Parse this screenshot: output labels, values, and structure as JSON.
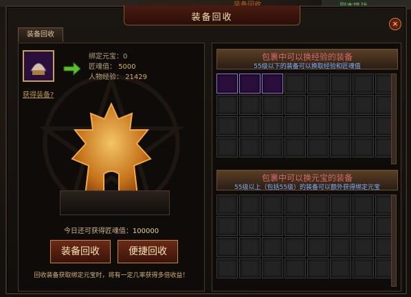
{
  "background": {
    "top_mid_text": "装备回收",
    "top_right_text": "副本挑战"
  },
  "window": {
    "title": "装备回收",
    "close_label": "×",
    "tab_label": "装备回收"
  },
  "left": {
    "bound_gold_label": "绑定元宝：0",
    "soul_label": "匠魂值：",
    "soul_value": "5000",
    "exp_label": "人物经验：",
    "exp_value": "21429",
    "get_equipment_link": "获得装备?",
    "today_label": "今日还可获得匠魂值：",
    "today_value": "100000",
    "recycle_button": "装备回收",
    "quick_recycle_button": "便捷回收",
    "note": "回收装备获取绑定元宝时，将有一定几率获得多倍收益！"
  },
  "right": {
    "exp_header": "包裹中可以换经验的装备",
    "exp_sub": "55级以下的装备可以换取经验和匠魂值",
    "gold_header": "包裹中可以换元宝的装备",
    "gold_sub": "55级以上（包括55级）的装备可以额外获得绑定元宝"
  },
  "colors": {
    "accent_gold": "#c9a24f",
    "header_red": "#d66a6a",
    "sub_blue": "#7fb0ff"
  }
}
